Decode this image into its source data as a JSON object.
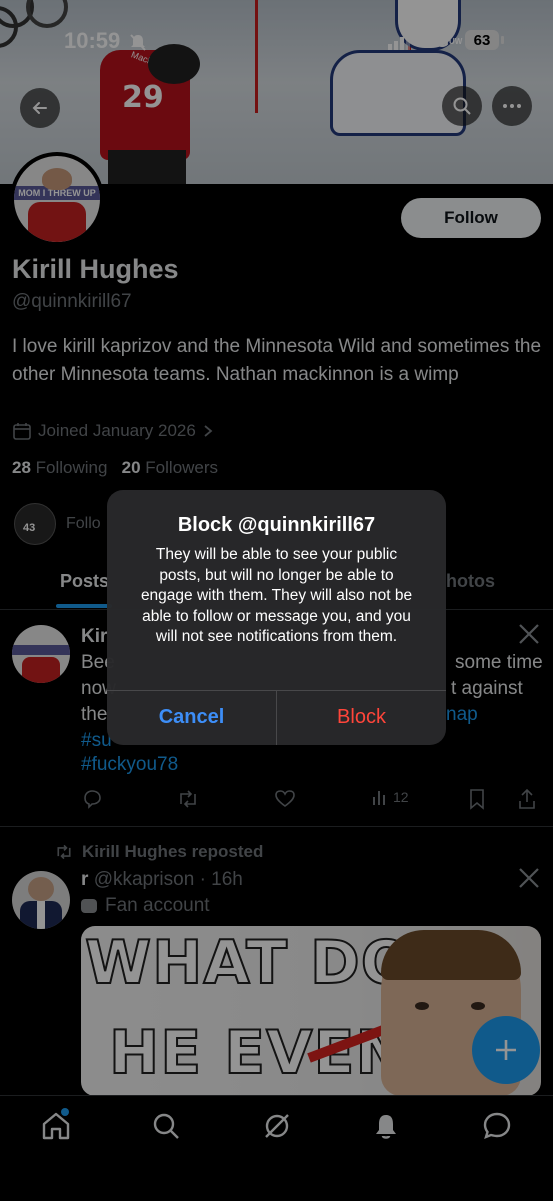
{
  "status_bar": {
    "time": "10:59",
    "network": "5G",
    "network_suffix": "UW",
    "battery": "63"
  },
  "profile": {
    "display_name": "Kirill Hughes",
    "handle": "@quinnkirill67",
    "bio": "I love kirill kaprizov and the Minnesota Wild and sometimes the other Minnesota teams. Nathan mackinnon is a wimp",
    "joined": "Joined January 2026",
    "following_count": "28",
    "following_label": "Following",
    "followers_count": "20",
    "followers_label": "Followers",
    "follow_button": "Follow",
    "avatar_caption": "MOM I THREW UP",
    "followed_by_snippet": "Follo"
  },
  "banner": {
    "jersey_number": "29",
    "jersey_name": "MacKINNON"
  },
  "tabs": [
    {
      "label": "Posts"
    },
    {
      "label": "hotos"
    }
  ],
  "post1": {
    "author_snippet": "Kir",
    "lines": [
      "Bee",
      "now",
      "the"
    ],
    "right_fragments": [
      "some time",
      "t against",
      "nap"
    ],
    "hashtags_line": "#su",
    "hashtag": "#fuckyou78",
    "views": "12"
  },
  "post2": {
    "repost_label": "Kirill Hughes reposted",
    "author": "r",
    "handle_time": "@kkaprison · 16h",
    "badge": "Fan account",
    "meme_line1": "WHAT DOES",
    "meme_line2": "HE EVEN"
  },
  "dialog": {
    "title": "Block @quinnkirill67",
    "message": "They will be able to see your public posts, but will no longer be able to engage with them. They will also not be able to follow or message you, and you will not see notifications from them.",
    "cancel": "Cancel",
    "confirm": "Block"
  },
  "colors": {
    "accent": "#1d9bf0",
    "destructive": "#ff453a",
    "dialog_button_blue": "#0a84ff"
  }
}
